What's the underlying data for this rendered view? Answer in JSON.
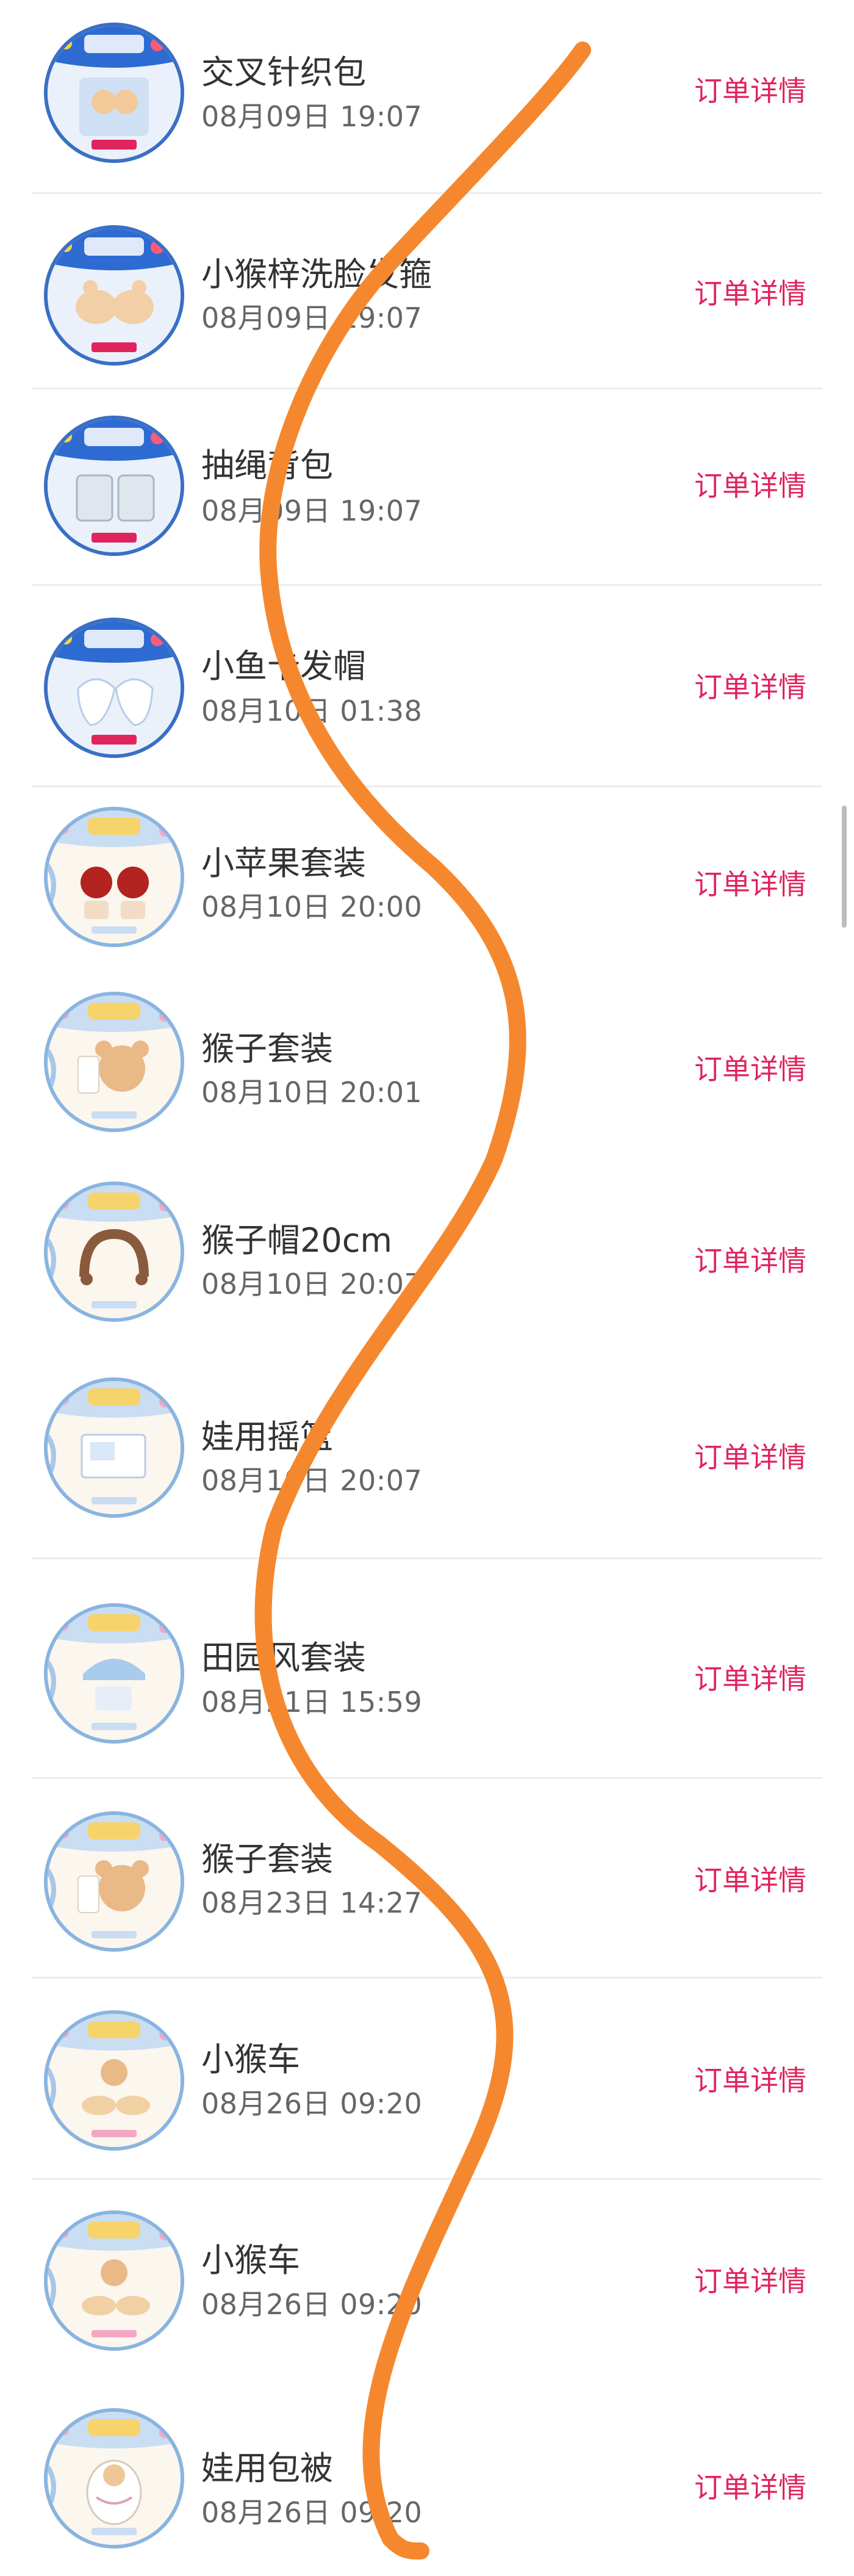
{
  "orders": [
    {
      "title": "交叉针织包",
      "time": "08月09日 19:07",
      "action": "订单详情",
      "thumb_style": "bold",
      "accent": "#3a6fc4"
    },
    {
      "title": "小猴梓洗脸发箍",
      "time": "08月09日 19:07",
      "action": "订单详情",
      "thumb_style": "bold",
      "accent": "#3a6fc4"
    },
    {
      "title": "抽绳背包",
      "time": "08月09日 19:07",
      "action": "订单详情",
      "thumb_style": "bold",
      "accent": "#3a6fc4"
    },
    {
      "title": "小鱼卡发帽",
      "time": "08月10日 01:38",
      "action": "订单详情",
      "thumb_style": "bold",
      "accent": "#3a6fc4"
    },
    {
      "title": "小苹果套装",
      "time": "08月10日 20:00",
      "action": "订单详情",
      "thumb_style": "pastel",
      "accent": "#8ab4e0"
    },
    {
      "title": "猴子套装",
      "time": "08月10日 20:01",
      "action": "订单详情",
      "thumb_style": "pastel",
      "accent": "#8ab4e0"
    },
    {
      "title": "猴子帽20cm",
      "time": "08月10日 20:07",
      "action": "订单详情",
      "thumb_style": "pastel",
      "accent": "#8ab4e0"
    },
    {
      "title": "娃用摇篮",
      "time": "08月10日 20:07",
      "action": "订单详情",
      "thumb_style": "pastel",
      "accent": "#8ab4e0"
    },
    {
      "title": "田园风套装",
      "time": "08月21日 15:59",
      "action": "订单详情",
      "thumb_style": "pastel",
      "accent": "#8ab4e0"
    },
    {
      "title": "猴子套装",
      "time": "08月23日 14:27",
      "action": "订单详情",
      "thumb_style": "pastel",
      "accent": "#8ab4e0"
    },
    {
      "title": "小猴车",
      "time": "08月26日 09:20",
      "action": "订单详情",
      "thumb_style": "pastel",
      "accent": "#8ab4e0"
    },
    {
      "title": "小猴车",
      "time": "08月26日 09:20",
      "action": "订单详情",
      "thumb_style": "pastel",
      "accent": "#8ab4e0"
    },
    {
      "title": "娃用包被",
      "time": "08月26日 09:20",
      "action": "订单详情",
      "thumb_style": "pastel",
      "accent": "#8ab4e0"
    }
  ],
  "colors": {
    "action_text": "#e0245e",
    "scribble": "#f5882e",
    "divider": "#ececec"
  },
  "overlay": {
    "type": "freehand-scribble",
    "icon": "scribble-line"
  }
}
